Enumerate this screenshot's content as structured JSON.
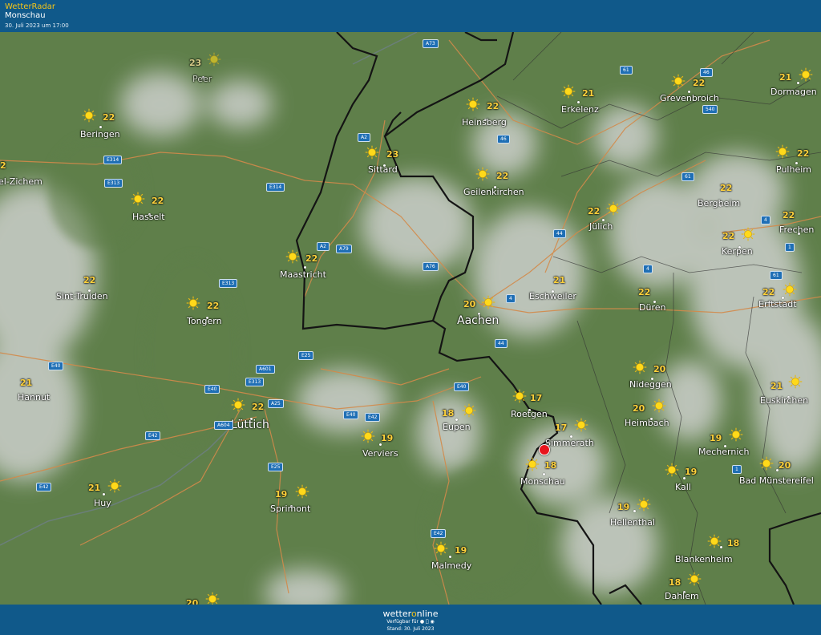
{
  "header": {
    "app_name": "WetterRadar",
    "location": "Monschau",
    "timestamp": "30. Juli 2023 um 17:00"
  },
  "footer": {
    "brand_a": "wetter",
    "brand_o": "o",
    "brand_b": "nline",
    "available": "Verfügbar für",
    "stand": "Stand: 30. Juli 2023"
  },
  "colors": {
    "header_bg": "#10598a",
    "accent": "#f5c518",
    "forest": "#5f7f4a",
    "cloud": "#c8ccc6",
    "border": "#141414",
    "road": "#d38a4a",
    "pin": "#e8141c"
  },
  "selected_location": "Monschau",
  "cities": [
    {
      "name": "Peer",
      "temp": "23",
      "icon": "sun-icon",
      "faded": true
    },
    {
      "name": "Beringen",
      "temp": "22",
      "icon": "sun-icon"
    },
    {
      "name": "el-Zichem",
      "temp": "2",
      "icon": ""
    },
    {
      "name": "Hasselt",
      "temp": "22",
      "icon": "sun-icon"
    },
    {
      "name": "Sittard",
      "temp": "23",
      "icon": "sun-icon"
    },
    {
      "name": "Heinsberg",
      "temp": "22",
      "icon": "sun-icon"
    },
    {
      "name": "Erkelenz",
      "temp": "21",
      "icon": "sun-icon"
    },
    {
      "name": "Grevenbroich",
      "temp": "22",
      "icon": "sun-icon"
    },
    {
      "name": "Dormagen",
      "temp": "21",
      "icon": "sun-icon"
    },
    {
      "name": "Geilenkirchen",
      "temp": "22",
      "icon": "sun-icon"
    },
    {
      "name": "Pulheim",
      "temp": "22",
      "icon": "sun-icon"
    },
    {
      "name": "Jülich",
      "temp": "22",
      "icon": "sun-icon"
    },
    {
      "name": "Bergheim",
      "temp": "22",
      "icon": ""
    },
    {
      "name": "Frechen",
      "temp": "22",
      "icon": ""
    },
    {
      "name": "Kerpen",
      "temp": "22",
      "icon": "sun-icon"
    },
    {
      "name": "Maastricht",
      "temp": "22",
      "icon": "sun-icon"
    },
    {
      "name": "Sint-Truiden",
      "temp": "22",
      "icon": ""
    },
    {
      "name": "Tongern",
      "temp": "22",
      "icon": "sun-icon"
    },
    {
      "name": "Eschweiler",
      "temp": "21",
      "icon": ""
    },
    {
      "name": "Aachen",
      "temp": "20",
      "icon": "sun-icon",
      "big": true
    },
    {
      "name": "Düren",
      "temp": "22",
      "icon": ""
    },
    {
      "name": "Erftstadt",
      "temp": "22",
      "icon": "sun-icon"
    },
    {
      "name": "Hannut",
      "temp": "21",
      "icon": ""
    },
    {
      "name": "Lüttich",
      "temp": "22",
      "icon": "sun-icon",
      "big": true
    },
    {
      "name": "Nideggen",
      "temp": "20",
      "icon": "sun-icon"
    },
    {
      "name": "Euskirchen",
      "temp": "21",
      "icon": "sun-icon"
    },
    {
      "name": "Roetgen",
      "temp": "17",
      "icon": "sun-icon"
    },
    {
      "name": "Eupen",
      "temp": "18",
      "icon": "sun-icon"
    },
    {
      "name": "Heimbach",
      "temp": "20",
      "icon": "sun-icon"
    },
    {
      "name": "Verviers",
      "temp": "19",
      "icon": "sun-icon"
    },
    {
      "name": "Simmerath",
      "temp": "17",
      "icon": "sun-icon"
    },
    {
      "name": "Mechernich",
      "temp": "19",
      "icon": "sun-icon"
    },
    {
      "name": "Monschau",
      "temp": "18",
      "icon": "sun-icon"
    },
    {
      "name": "Kall",
      "temp": "19",
      "icon": "sun-icon"
    },
    {
      "name": "Bad Münstereifel",
      "temp": "20",
      "icon": "sun-icon"
    },
    {
      "name": "Huy",
      "temp": "21",
      "icon": "sun-icon"
    },
    {
      "name": "Sprimont",
      "temp": "19",
      "icon": "sun-icon"
    },
    {
      "name": "Hellenthal",
      "temp": "19",
      "icon": "sun-icon"
    },
    {
      "name": "Blankenheim",
      "temp": "18",
      "icon": "sun-icon"
    },
    {
      "name": "Malmedy",
      "temp": "19",
      "icon": "sun-icon"
    },
    {
      "name": "Dahlem",
      "temp": "18",
      "icon": "sun-icon"
    },
    {
      "name": "",
      "temp": "20",
      "icon": "sun-icon"
    }
  ],
  "road_labels": [
    "A73",
    "61",
    "46",
    "540",
    "A2",
    "46",
    "E314",
    "E313",
    "E314",
    "A2",
    "A79",
    "61",
    "4",
    "44",
    "4",
    "A76",
    "E313",
    "1",
    "4",
    "61",
    "E25",
    "E40",
    "A601",
    "E313",
    "E40",
    "A25",
    "E40",
    "A604",
    "E42",
    "E40",
    "44",
    "E42",
    "E25",
    "E42",
    "1",
    "E42"
  ]
}
